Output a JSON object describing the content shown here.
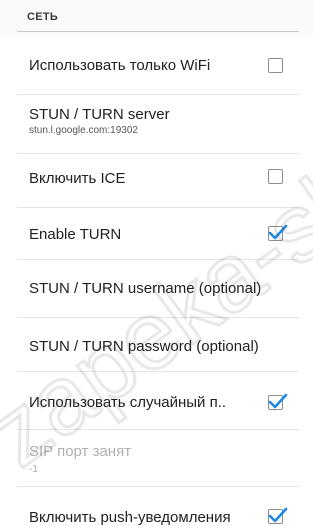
{
  "section": {
    "title": "СЕТЬ"
  },
  "prefs": [
    {
      "label": "Использовать только WiFi",
      "checked": false
    },
    {
      "label": "STUN / TURN server",
      "summary": "stun.l.google.com:19302"
    },
    {
      "label": "Включить ICE",
      "checked": false
    },
    {
      "label": "Enable TURN",
      "checked": true
    },
    {
      "label": "STUN / TURN username (optional)"
    },
    {
      "label": "STUN / TURN password (optional)"
    },
    {
      "label": "Использовать случайный п..",
      "checked": true
    },
    {
      "label": "SIP порт занят",
      "summary": "-1",
      "disabled": true
    },
    {
      "label": "Включить push-уведомления",
      "checked": true
    }
  ],
  "watermark": {
    "text": "zapeka-sh"
  },
  "colors": {
    "check_blue": "#1e88e5",
    "divider": "#e4e4e4",
    "disabled_text": "#b0b0b0"
  }
}
